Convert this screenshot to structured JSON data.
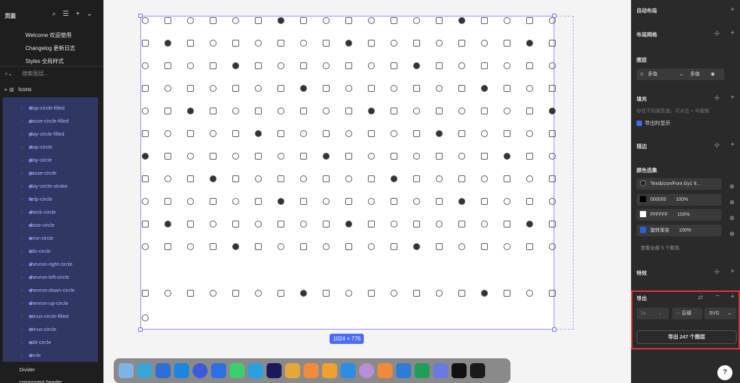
{
  "left": {
    "title": "页面",
    "pages": [
      "Welcome 欢迎使用",
      "Changelog 更新日志",
      "Styles 全局样式"
    ],
    "search_placeholder": "搜索图层...",
    "frame": "Icons",
    "layers": [
      "stop-circle-filled",
      "pause-circle-filled",
      "play-circle-filled",
      "stop-circle",
      "play-circle",
      "pause-circle",
      "play-circle-stroke",
      "help-circle",
      "check-circle",
      "close-circle",
      "error-circle",
      "info-circle",
      "chevron-right-circle",
      "chevron-left-circle",
      "chevron-down-circle",
      "chevron-up-circle",
      "minus-circle-filled",
      "minus-circle",
      "add-circle",
      "circle"
    ],
    "after": [
      "Divider",
      "component header"
    ]
  },
  "canvas": {
    "size_label": "1024 × 776"
  },
  "right": {
    "auto_layout": "自动布局",
    "layout_grid": "布局网格",
    "layer": "图层",
    "mixed1": "多值",
    "mixed2": "多值",
    "fill": "填充",
    "fill_note": "存在不同属性值，可点击 + 号替换",
    "export_show": "导出时显示",
    "stroke": "描边",
    "colors": "颜色选集",
    "color_rows": [
      {
        "name": "Text&Icon/Font Gy1 9...",
        "pct": ""
      },
      {
        "name": "000000",
        "pct": "100%"
      },
      {
        "name": "FFFFFF",
        "pct": "100%"
      },
      {
        "name": "旋转渐变",
        "pct": "100%"
      }
    ],
    "view_all": "查看全部 5 个颜色",
    "effects": "特效",
    "export": "导出",
    "scale": "1x",
    "suffix": "··· 后缀",
    "format": "SVG",
    "export_btn": "导出 247 个图层"
  }
}
